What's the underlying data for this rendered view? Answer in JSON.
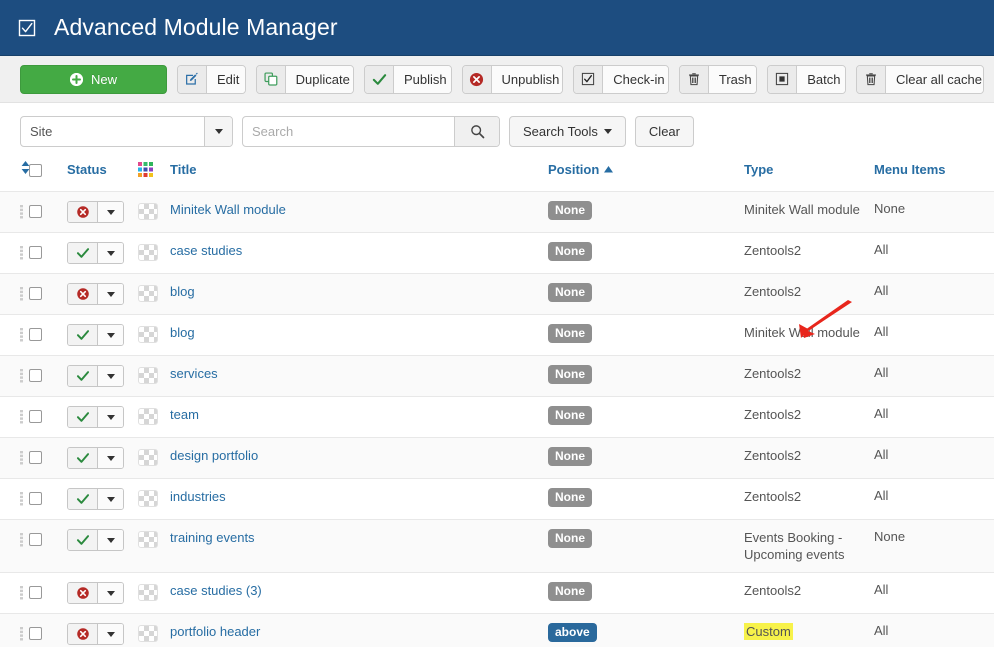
{
  "header": {
    "icon": "checkbox-check-icon",
    "title": "Advanced Module Manager",
    "bg_color": "#1d4d80"
  },
  "toolbar": {
    "new_label": "New",
    "new_color": "#44aa44",
    "buttons": [
      {
        "icon": "edit-pencil-square-icon",
        "label": "Edit"
      },
      {
        "icon": "copy-duplicate-icon",
        "label": "Duplicate"
      },
      {
        "icon": "check-icon",
        "label": "Publish"
      },
      {
        "icon": "cancel-circle-icon",
        "label": "Unpublish"
      },
      {
        "icon": "checkbox-check-icon",
        "label": "Check-in"
      },
      {
        "icon": "trash-icon",
        "label": "Trash"
      },
      {
        "icon": "square-filled-icon",
        "label": "Batch"
      },
      {
        "icon": "trash-icon",
        "label": "Clear all cache"
      }
    ]
  },
  "filterbar": {
    "site_select_value": "Site",
    "search_placeholder": "Search",
    "search_value": "",
    "search_icon": "magnifier-icon",
    "search_tools_label": "Search Tools",
    "clear_label": "Clear"
  },
  "table": {
    "columns": {
      "ordering": "ordering-sort-icon",
      "select_all": "select-all-checkbox",
      "status": "Status",
      "module_icon": "colored-module-grid-icon",
      "title": "Title",
      "position": "Position",
      "position_sort": "ascending",
      "type": "Type",
      "menu_items": "Menu Items"
    },
    "rows": [
      {
        "status": "unpublished",
        "title": "Minitek Wall module",
        "position": "None",
        "position_style": "none",
        "type": "Minitek Wall module",
        "type_highlight": false,
        "menu_items": "None"
      },
      {
        "status": "published",
        "title": "case studies",
        "position": "None",
        "position_style": "none",
        "type": "Zentools2",
        "type_highlight": false,
        "menu_items": "All"
      },
      {
        "status": "unpublished",
        "title": "blog",
        "position": "None",
        "position_style": "none",
        "type": "Zentools2",
        "type_highlight": false,
        "menu_items": "All"
      },
      {
        "status": "published",
        "title": "blog",
        "position": "None",
        "position_style": "none",
        "type": "Minitek Wall module",
        "type_highlight": false,
        "menu_items": "All"
      },
      {
        "status": "published",
        "title": "services",
        "position": "None",
        "position_style": "none",
        "type": "Zentools2",
        "type_highlight": false,
        "menu_items": "All"
      },
      {
        "status": "published",
        "title": "team",
        "position": "None",
        "position_style": "none",
        "type": "Zentools2",
        "type_highlight": false,
        "menu_items": "All"
      },
      {
        "status": "published",
        "title": "design portfolio",
        "position": "None",
        "position_style": "none",
        "type": "Zentools2",
        "type_highlight": false,
        "menu_items": "All"
      },
      {
        "status": "published",
        "title": "industries",
        "position": "None",
        "position_style": "none",
        "type": "Zentools2",
        "type_highlight": false,
        "menu_items": "All"
      },
      {
        "status": "published",
        "title": "training events",
        "position": "None",
        "position_style": "none",
        "type": "Events Booking - Upcoming events",
        "type_highlight": false,
        "menu_items": "None"
      },
      {
        "status": "unpublished",
        "title": "case studies (3)",
        "position": "None",
        "position_style": "none",
        "type": "Zentools2",
        "type_highlight": false,
        "menu_items": "All"
      },
      {
        "status": "unpublished",
        "title": "portfolio header",
        "position": "above",
        "position_style": "above",
        "type": "Custom",
        "type_highlight": true,
        "menu_items": "All"
      }
    ]
  },
  "annotation": {
    "arrow": "red-arrow-pointing-to-type-column",
    "color": "#e8261c"
  }
}
